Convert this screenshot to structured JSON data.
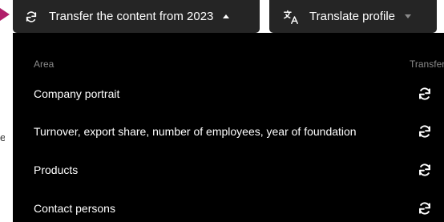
{
  "toolbar": {
    "transfer_label": "Transfer the content from 2023",
    "transfer_icon": "sync-icon",
    "translate_label": "Translate profile",
    "translate_icon": "translate-icon",
    "colors": {
      "button_bg": "#252525",
      "panel_bg": "#000000",
      "header_text": "#8a8a8a",
      "accent": "#b01e6a"
    }
  },
  "dropdown": {
    "headers": {
      "area": "Area",
      "transfer": "Transfer"
    },
    "rows": [
      {
        "label": "Company portrait",
        "icon": "sync-icon"
      },
      {
        "label": "Turnover, export share, number of employees, year of foundation",
        "icon": "sync-icon"
      },
      {
        "label": "Products",
        "icon": "sync-icon"
      },
      {
        "label": "Contact persons",
        "icon": "sync-icon"
      }
    ]
  },
  "background": {
    "partial_text": "e"
  }
}
